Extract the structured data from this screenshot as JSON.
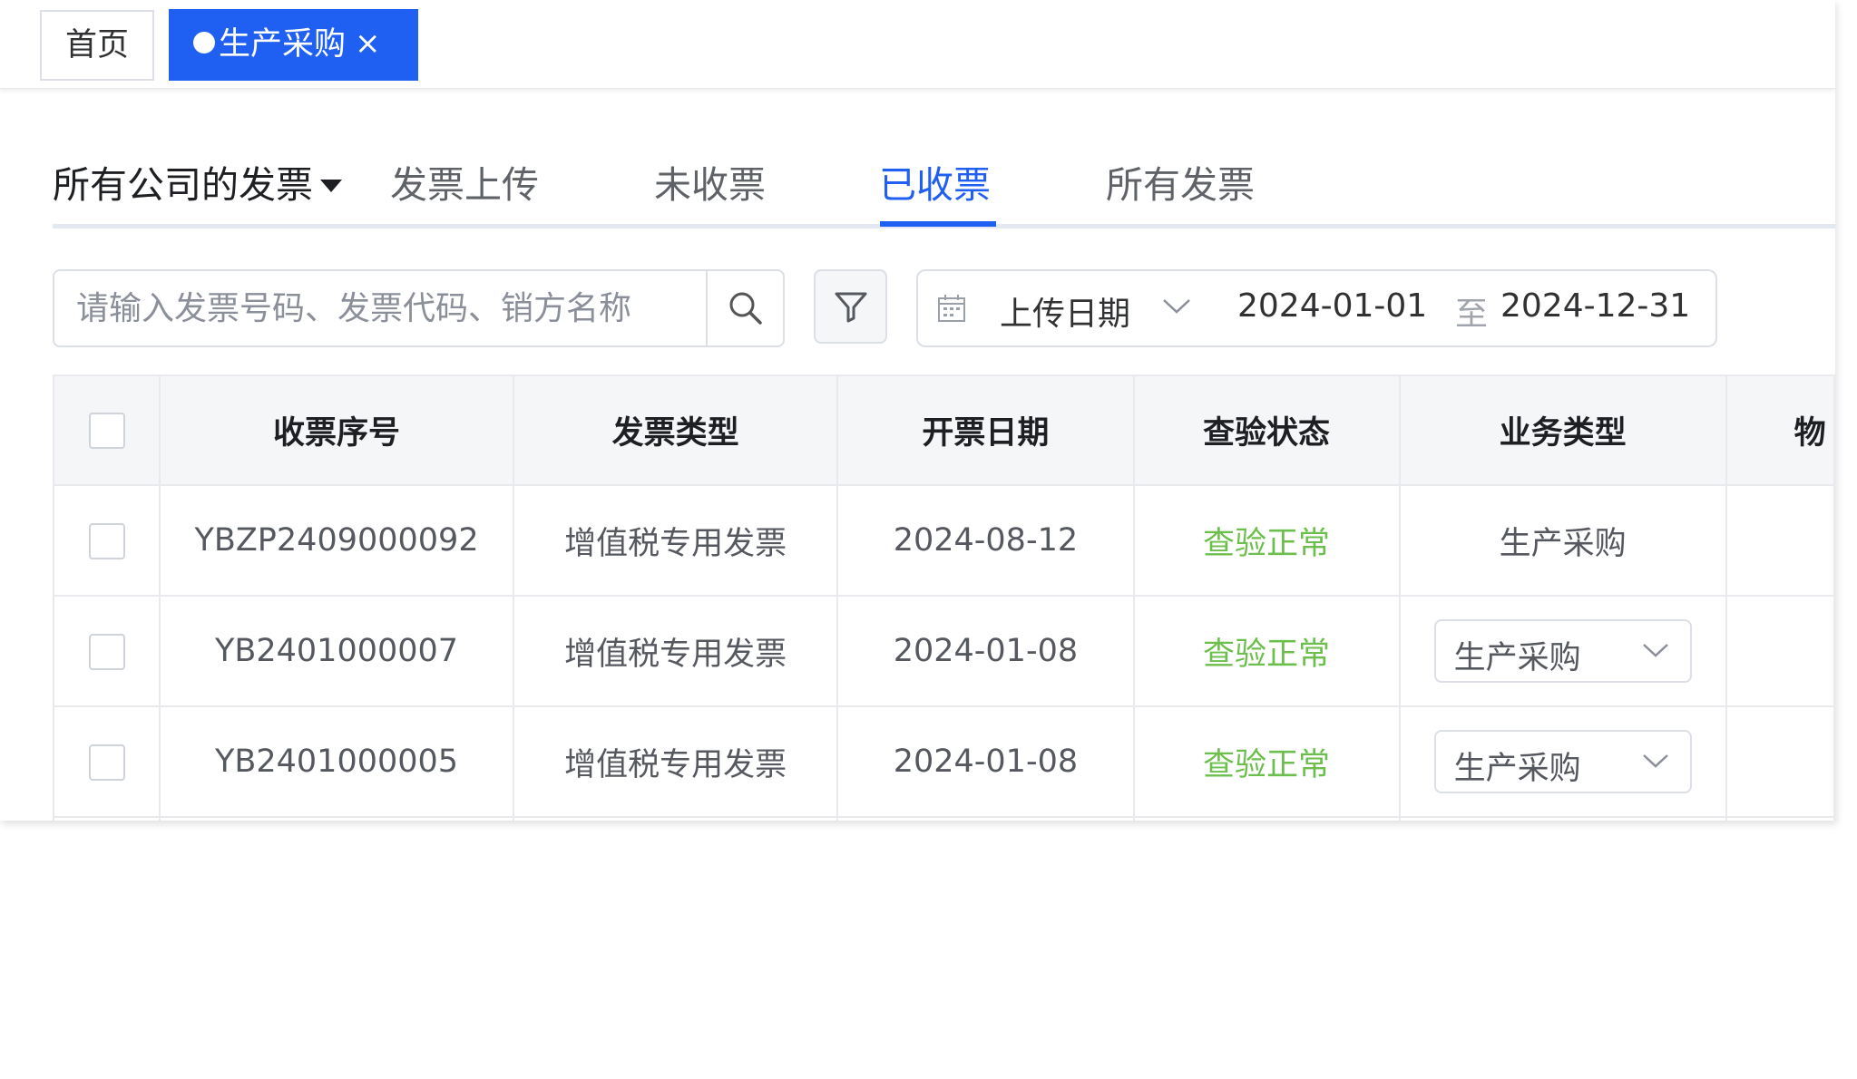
{
  "tabs": {
    "home_label": "首页",
    "active_label": "生产采购",
    "active_close": "×"
  },
  "subnav": {
    "company_label": "所有公司的发票",
    "items": [
      "发票上传",
      "未收票",
      "已收票",
      "所有发票"
    ],
    "active_index": 2
  },
  "search": {
    "placeholder": "请输入发票号码、发票代码、销方名称"
  },
  "date_filter": {
    "field_label": "上传日期",
    "start": "2024-01-01",
    "separator": "至",
    "end": "2024-12-31"
  },
  "table": {
    "columns": [
      "收票序号",
      "发票类型",
      "开票日期",
      "查验状态",
      "业务类型",
      "物"
    ],
    "rows": [
      {
        "no": "YBZP2409000092",
        "type": "增值税专用发票",
        "date": "2024-08-12",
        "status": "查验正常",
        "biz": "生产采购"
      },
      {
        "no": "YB2401000007",
        "type": "增值税专用发票",
        "date": "2024-01-08",
        "status": "查验正常",
        "biz": "生产采购"
      },
      {
        "no": "YB2401000005",
        "type": "增值税专用发票",
        "date": "2024-01-08",
        "status": "查验正常",
        "biz": "生产采购"
      }
    ]
  },
  "colors": {
    "accent": "#1f5ff2",
    "status_ok": "#6cbf4c",
    "header_bg": "#f5f6f8"
  }
}
